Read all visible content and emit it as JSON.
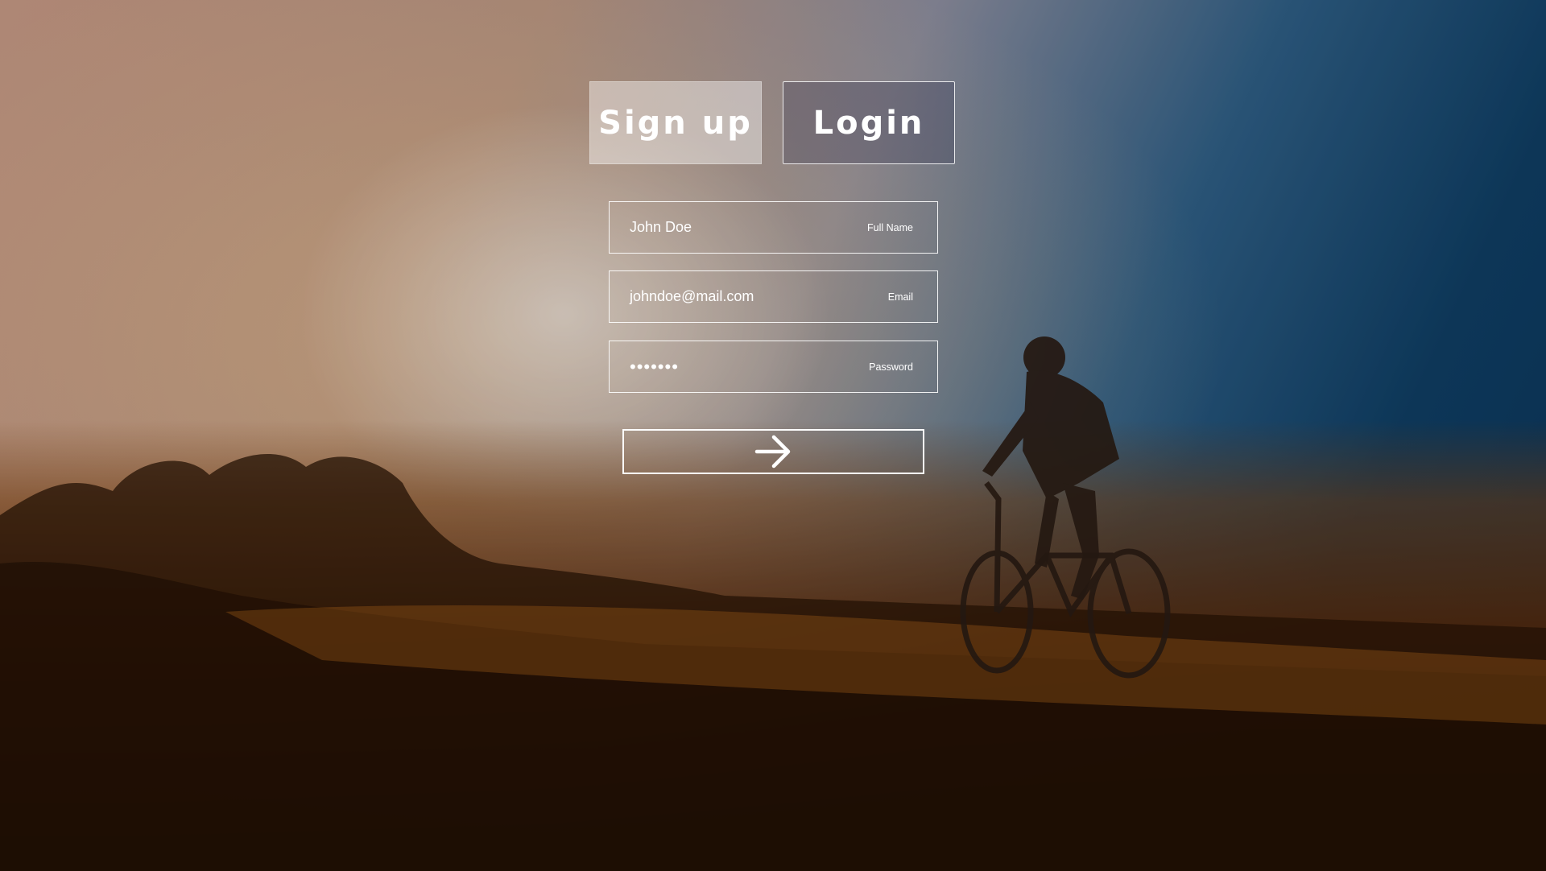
{
  "tabs": {
    "signup_label": "Sign up",
    "login_label": "Login",
    "active": "signup"
  },
  "form": {
    "full_name": {
      "value": "John Doe",
      "label": "Full Name"
    },
    "email": {
      "value": "johndoe@mail.com",
      "label": "Email"
    },
    "password": {
      "value": "•••••••",
      "label": "Password"
    }
  },
  "submit": {
    "icon": "arrow-right-icon"
  },
  "background": {
    "description_icon": "cyclist-sunset-photo"
  },
  "colors": {
    "text": "#ffffff",
    "border": "#ffffff"
  }
}
